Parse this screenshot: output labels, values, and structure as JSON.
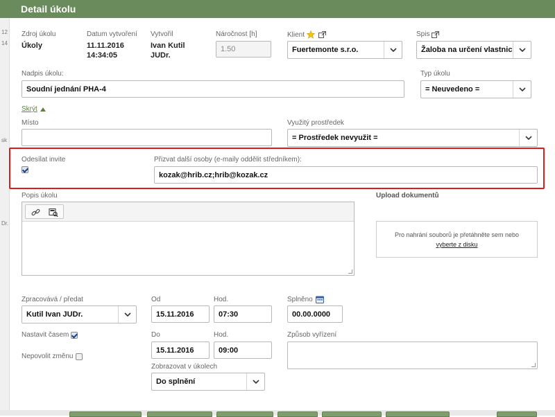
{
  "dialog": {
    "title": "Detail úkolu"
  },
  "background_fragments": [
    "12",
    "14",
    "sk",
    "Dr."
  ],
  "meta": {
    "source_label": "Zdroj úkolu",
    "source_value": "Úkoly",
    "created_label": "Datum vytvoření",
    "created_date": "11.11.2016",
    "created_time": "14:34:05",
    "author_label": "Vytvořil",
    "author_line1": "Ivan Kutil",
    "author_line2": "JUDr.",
    "difficulty_label": "Náročnost [h]",
    "difficulty_value": "1.50",
    "client_label": "Klient",
    "client_value": "Fuertemonte s.r.o.",
    "file_label": "Spis",
    "file_value": "Žaloba na určení vlastnic"
  },
  "task": {
    "heading_label": "Nadpis úkolu:",
    "heading_value": "Soudní jednání PHA-4",
    "type_label": "Typ úkolu",
    "type_value": "= Neuvedeno =",
    "hide_link": "Skrýt",
    "place_label": "Místo",
    "place_value": "",
    "resource_label": "Využitý prostředek",
    "resource_value": "= Prostředek nevyužit ="
  },
  "invite": {
    "send_label": "Odesílat invite",
    "send_checked": true,
    "others_label": "Přizvat další osoby (e-maily oddělit středníkem):",
    "others_value": "kozak@hrib.cz;hrib@kozak.cz"
  },
  "description": {
    "label": "Popis úkolu",
    "upload_label": "Upload dokumentů",
    "upload_text": "Pro nahrání souborů je přetáhněte sem nebo",
    "upload_link": "vyberte z disku"
  },
  "assign": {
    "assignee_label": "Zpracovává / předat",
    "assignee_value": "Kutil Ivan JUDr.",
    "from_label": "Od",
    "from_date": "15.11.2016",
    "from_hour_label": "Hod.",
    "from_hour": "07:30",
    "done_label": "Splněno",
    "done_value": "00.00.0000",
    "set_time_label": "Nastavit časem",
    "set_time_checked": true,
    "to_label": "Do",
    "to_date": "15.11.2016",
    "to_hour_label": "Hod.",
    "to_hour": "09:00",
    "resolution_label": "Způsob vyřízení",
    "no_change_label": "Nepovolit změnu",
    "no_change_checked": false,
    "show_label": "Zobrazovat v úkolech",
    "show_value": "Do splnění"
  },
  "colors": {
    "header": "#6a8b5c",
    "highlight": "#e01818",
    "link": "#5e7f3f"
  }
}
